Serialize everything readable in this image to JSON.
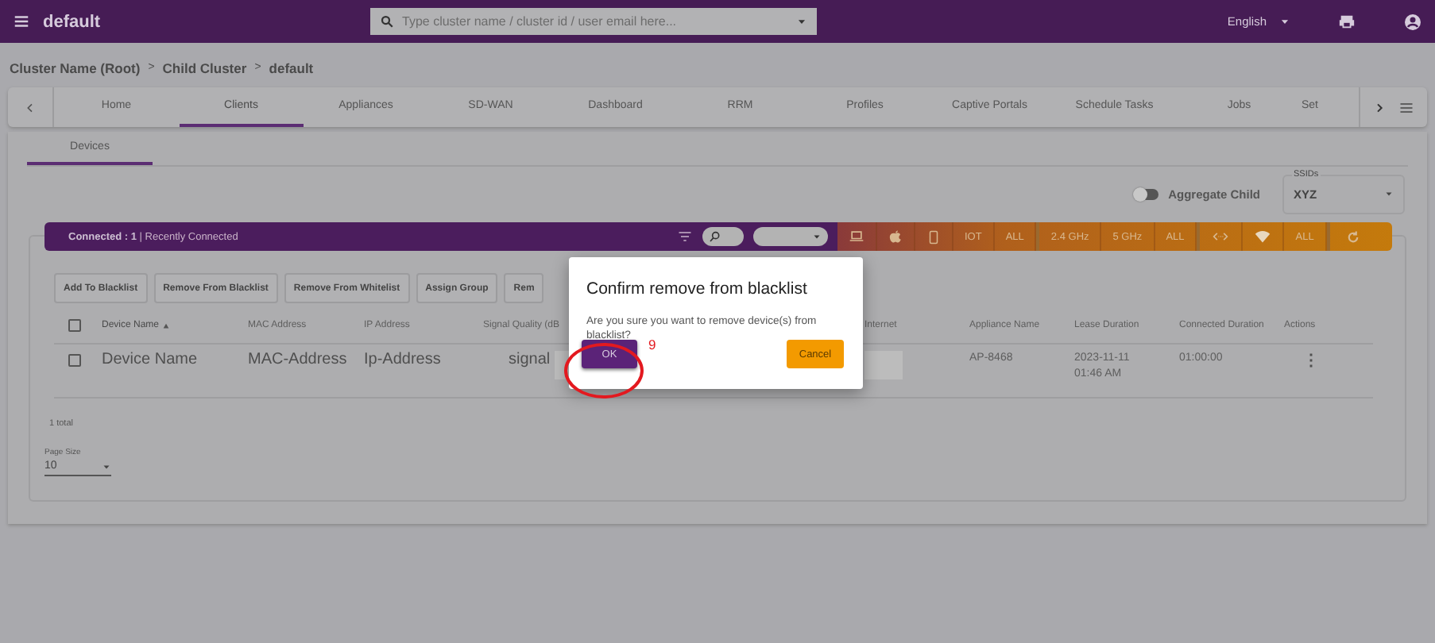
{
  "topbar": {
    "title": "default",
    "search": {
      "placeholder": "Type cluster name / cluster id / user email here..."
    },
    "language": "English"
  },
  "breadcrumb": [
    {
      "label": "Cluster Name (Root)",
      "separator": ">"
    },
    {
      "label": "Child Cluster",
      "separator": ">"
    },
    {
      "label": "default"
    }
  ],
  "tabs": [
    {
      "label": "Home",
      "selected": false
    },
    {
      "label": "Clients",
      "selected": true
    },
    {
      "label": "Appliances",
      "selected": false
    },
    {
      "label": "SD-WAN",
      "selected": false
    },
    {
      "label": "Dashboard",
      "selected": false
    },
    {
      "label": "RRM",
      "selected": false
    },
    {
      "label": "Profiles",
      "selected": false
    },
    {
      "label": "Captive Portals",
      "selected": false
    },
    {
      "label": "Schedule Tasks",
      "selected": false
    },
    {
      "label": "Jobs",
      "selected": false
    },
    {
      "label": "Set",
      "selected": false
    }
  ],
  "subtabs": [
    {
      "label": "Devices",
      "selected": true
    }
  ],
  "aggregate_child": {
    "label": "Aggregate Child",
    "on": false
  },
  "ssids": {
    "label": "SSIDs",
    "value": "XYZ"
  },
  "filter_bar": {
    "summary": "**Connected : 1** | Recently Connected",
    "device_filters": [
      "IOT",
      "ALL"
    ],
    "band_filters": [
      "2.4 GHz",
      "5 GHz",
      "ALL"
    ],
    "link_filters": [
      "ALL"
    ]
  },
  "actions": [
    "Add To Blacklist",
    "Remove From Blacklist",
    "Remove From Whitelist",
    "Assign Group",
    "Rem"
  ],
  "table": {
    "select_all": {
      "checked": false
    },
    "columns": [
      {
        "label": "Device Name",
        "sorted": true
      },
      {
        "label": "MAC Address",
        "sorted": false
      },
      {
        "label": "IP Address",
        "sorted": false
      },
      {
        "label": "Signal Quality (dB",
        "sorted": false
      },
      {
        "label": "Internet",
        "sorted": false
      },
      {
        "label": "Appliance Name",
        "sorted": false
      },
      {
        "label": "Lease Duration",
        "sorted": false
      },
      {
        "label": "Connected Duration",
        "sorted": false
      },
      {
        "label": "Actions",
        "sorted": false
      }
    ],
    "rows": [
      {
        "checked": false,
        "device_name": "Device Name",
        "mac": "MAC-Address",
        "ip": "Ip-Address",
        "signal": "signal",
        "appliance": "AP-8468",
        "lease": "2023-11-11 01:46 AM",
        "connected": "01:00:00",
        "actions": "⋮"
      }
    ]
  },
  "footer": {
    "total": "1 total",
    "page_size_label": "Page Size",
    "page_size": "10"
  },
  "dialog": {
    "title": "Confirm remove from blacklist",
    "message": "Are you sure you want to remove device(s) from blacklist?",
    "ok": "OK",
    "cancel": "Cancel",
    "annotation": "9"
  }
}
